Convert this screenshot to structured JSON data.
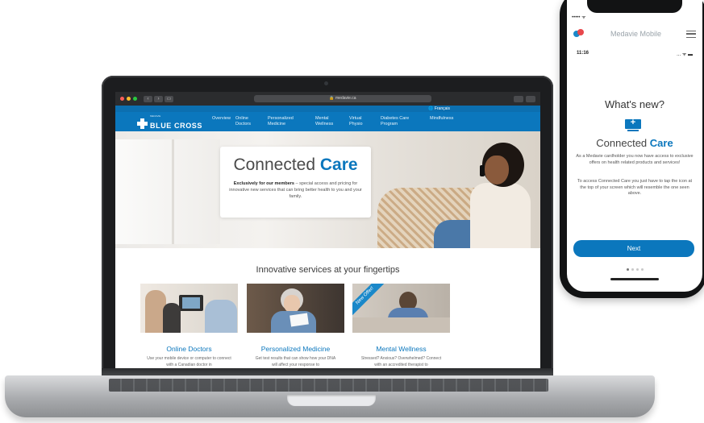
{
  "browser": {
    "url": "medavie.ca"
  },
  "site": {
    "lang_link": "🌐 Français",
    "logo_small": "MEDAVIE",
    "logo_name": "BLUE CROSS",
    "nav": [
      {
        "line1": "Overview",
        "line2": ""
      },
      {
        "line1": "Online",
        "line2": "Doctors"
      },
      {
        "line1": "Personalized",
        "line2": "Medicine"
      },
      {
        "line1": "Mental",
        "line2": "Wellness"
      },
      {
        "line1": "Virtual",
        "line2": "Physio"
      },
      {
        "line1": "Diabetes Care",
        "line2": "Program"
      },
      {
        "line1": "Mindfulness",
        "line2": ""
      }
    ]
  },
  "hero": {
    "title_plain": "Connected",
    "title_accent": "Care",
    "text_bold": "Exclusively for our members",
    "text_rest": " – special access and pricing for innovative new services that can bring better health to you and your family."
  },
  "services": {
    "title": "Innovative services at your fingertips",
    "cards": [
      {
        "label": "Online Doctors",
        "desc": "Use your mobile device or computer to connect with a Canadian doctor in"
      },
      {
        "label": "Personalized Medicine",
        "desc": "Get test results that can show how your DNA will affect your response to"
      },
      {
        "label": "Mental Wellness",
        "desc": "Stressed? Anxious? Overwhelmed? Connect with an accredited therapist to",
        "ribbon": "New Offer!"
      }
    ]
  },
  "phone": {
    "carrier": "••••• ᯤ",
    "app_title": "Medavie Mobile",
    "time": "11:16",
    "signal": "... ᯤ ▬",
    "whats_new": "What's new?",
    "cc_plain": "Connected",
    "cc_accent": "Care",
    "para1": "As a Medavie cardholder you now have access to exclusive offers on health related products and services!",
    "para2": "To access Connected Care you just have to tap the icon at the top of your screen which will resemble the one seen above.",
    "next_label": "Next",
    "pager_active_index": 0,
    "pager_count": 4
  },
  "colors": {
    "brand_blue": "#0b77bd",
    "nav_blue": "#0c6fb0"
  }
}
